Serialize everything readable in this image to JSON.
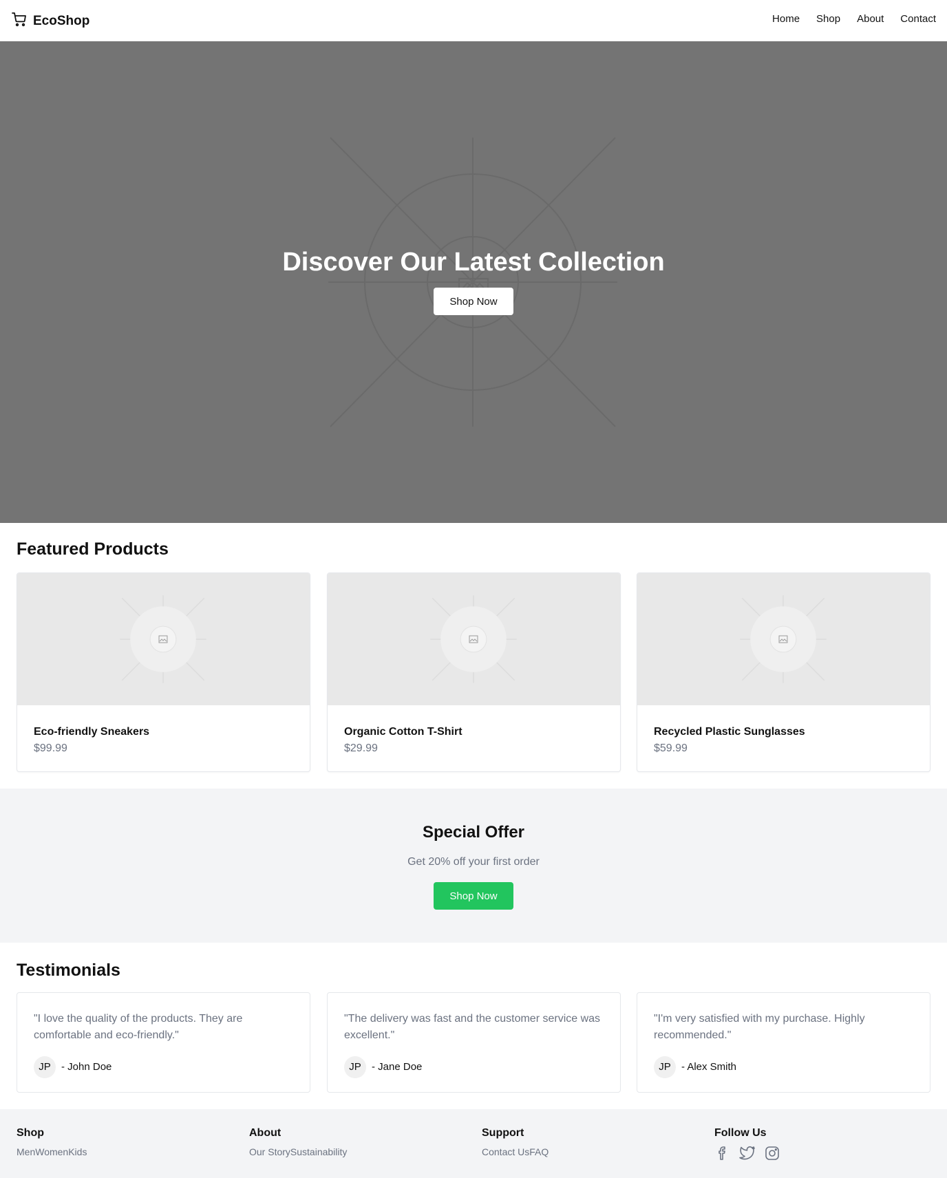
{
  "header": {
    "brand": "EcoShop",
    "brand_icon": "shopping-cart-icon",
    "nav": [
      "Home",
      "Shop",
      "About",
      "Contact"
    ]
  },
  "hero": {
    "title": "Discover Our Latest Collection",
    "button": "Shop Now"
  },
  "featured": {
    "title": "Featured Products",
    "products": [
      {
        "name": "Eco-friendly Sneakers",
        "price": "$99.99"
      },
      {
        "name": "Organic Cotton T-Shirt",
        "price": "$29.99"
      },
      {
        "name": "Recycled Plastic Sunglasses",
        "price": "$59.99"
      }
    ]
  },
  "offer": {
    "title": "Special Offer",
    "subtitle": "Get 20% off your first order",
    "button": "Shop Now",
    "button_color": "#22c55e"
  },
  "testimonials": {
    "title": "Testimonials",
    "items": [
      {
        "quote": "\"I love the quality of the products. They are comfortable and eco-friendly.\"",
        "initials": "JP",
        "author": "- John Doe"
      },
      {
        "quote": "\"The delivery was fast and the customer service was excellent.\"",
        "initials": "JP",
        "author": "- Jane Doe"
      },
      {
        "quote": "\"I'm very satisfied with my purchase. Highly recommended.\"",
        "initials": "JP",
        "author": "- Alex Smith"
      }
    ]
  },
  "footer": {
    "columns": [
      {
        "heading": "Shop",
        "links": "MenWomenKids"
      },
      {
        "heading": "About",
        "links": "Our StorySustainability"
      },
      {
        "heading": "Support",
        "links": "Contact UsFAQ"
      }
    ],
    "follow": {
      "heading": "Follow Us",
      "icons": [
        "facebook-icon",
        "twitter-icon",
        "instagram-icon"
      ]
    }
  }
}
